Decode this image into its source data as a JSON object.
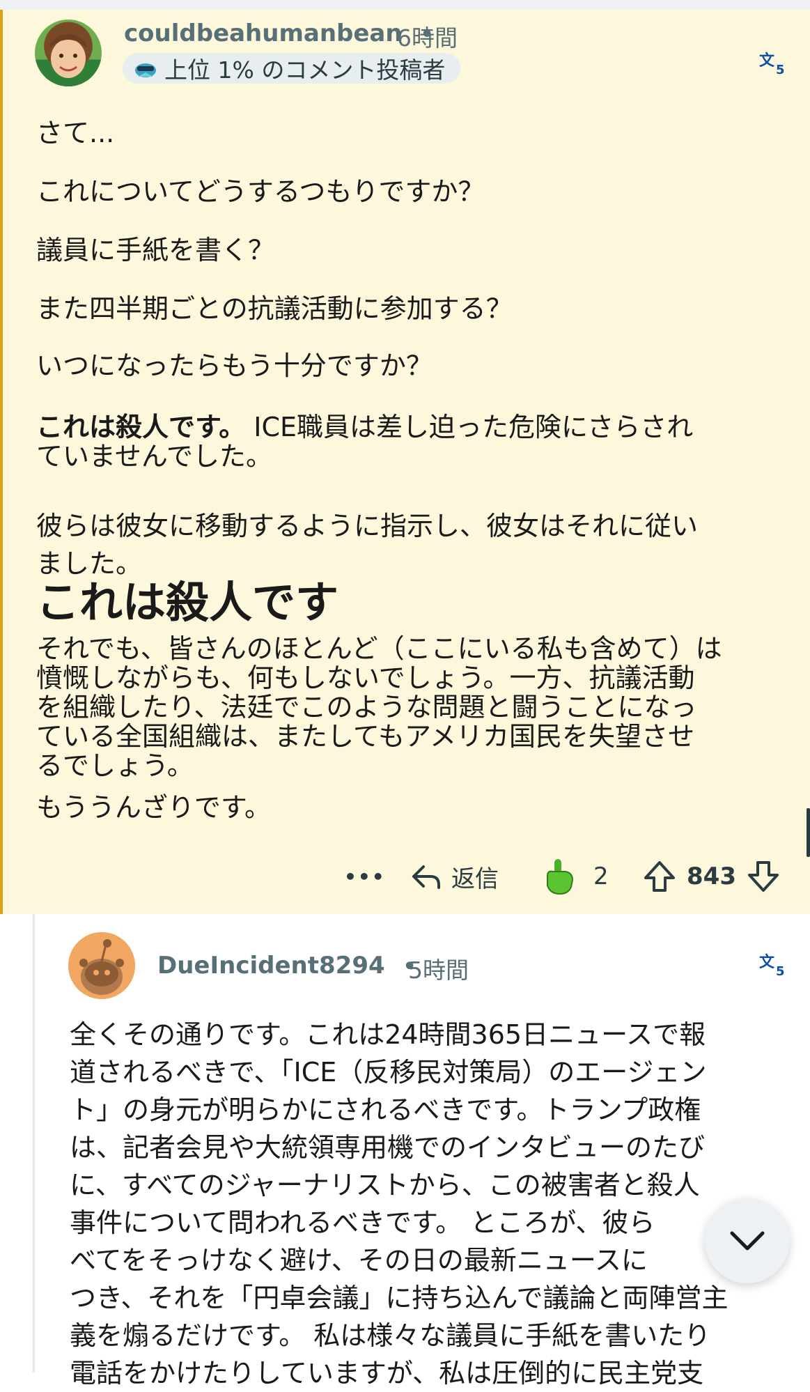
{
  "comment1": {
    "username": "couldbeahumanbean",
    "separator": "•",
    "time": "6時間",
    "badge": "上位 1% のコメント投稿者",
    "lines": [
      "さて...",
      "これについてどうするつもりですか？",
      "議員に手紙を書く？",
      "また四半期ごとの抗議活動に参加する？",
      "いつになったらもう十分ですか？"
    ],
    "bold_lead": "これは殺人です。",
    "p6_line1_rest": " ICE職員は差し迫った危険にさらされ",
    "p6_line2": "ていませんでした。",
    "p7_line1": "彼らは彼女に移動するように指示し、彼女はそれに従い",
    "p7_line2": "ました。",
    "heading": "これは殺人です",
    "p8": [
      "それでも、皆さんのほとんど（ここにいる私も含めて）は",
      "憤慨しながらも、何もしないでしょう。一方、抗議活動",
      "を組織したり、法廷でこのような問題と闘うことになっ",
      "ている全国組織は、またしてもアメリカ国民を失望させ",
      "るでしょう。"
    ],
    "closing": "もううんざりです。",
    "actions": {
      "more": "•••",
      "reply": "返信",
      "award_count": "2",
      "votes": "843"
    }
  },
  "comment2": {
    "username": "DueIncident8294",
    "separator": "•",
    "time": "5時間",
    "lines": [
      "全くその通りです。これは24時間365日ニュースで報",
      "道されるべきで、「ICE（反移民対策局）のエージェン",
      "ト」の身元が明らかにされるべきです。トランプ政権",
      "は、記者会見や大統領専用機でのインタビューのたび",
      "に、すべてのジャーナリストから、この被害者と殺人",
      "事件について問われるべきです。 ところが、彼ら",
      "べてをそっけなく避け、その日の最新ニュースに",
      "つき、それを「円卓会議」に持ち込んで議論と両陣営主",
      "義を煽るだけです。 私は様々な議員に手紙を書いたり",
      "電話をかけたりしていますが、私は圧倒的に民主党支"
    ]
  },
  "colors": {
    "highlight_bg": "#fdf7dc",
    "highlight_border": "#d9a21b",
    "meta_text": "#576f76",
    "link_blue": "#0a4fa8"
  }
}
